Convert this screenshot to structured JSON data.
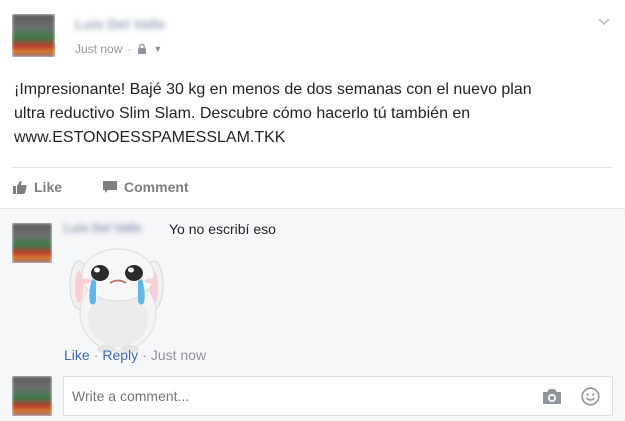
{
  "post": {
    "author": "Luis Del Valle",
    "timestamp": "Just now",
    "separator": "·",
    "privacy_icon": "lock-icon",
    "menu_icon": "chevron-down-icon",
    "body_line1": "¡Impresionante! Bajé 30 kg en menos de dos semanas con el nuevo plan",
    "body_line2": "ultra reductivo Slim Slam. Descubre cómo hacerlo tú también en",
    "body_line3": "www.ESTONOESSPAMESSLAM.TKK"
  },
  "actions": {
    "like_label": "Like",
    "comment_label": "Comment",
    "like_icon": "thumbs-up-icon",
    "comment_icon": "speech-bubble-icon"
  },
  "comment": {
    "author": "Luis Del Valle",
    "text": "Yo no escribí eso",
    "sticker": "crying-bunny-sticker",
    "like_label": "Like",
    "reply_label": "Reply",
    "dot": "·",
    "timestamp": "Just now"
  },
  "composer": {
    "placeholder": "Write a comment...",
    "camera_icon": "camera-icon",
    "emoji_icon": "smiley-icon"
  },
  "colors": {
    "link": "#4267b2",
    "muted": "#90949c",
    "text": "#1d2129",
    "comment_bg": "#f6f7f9"
  }
}
